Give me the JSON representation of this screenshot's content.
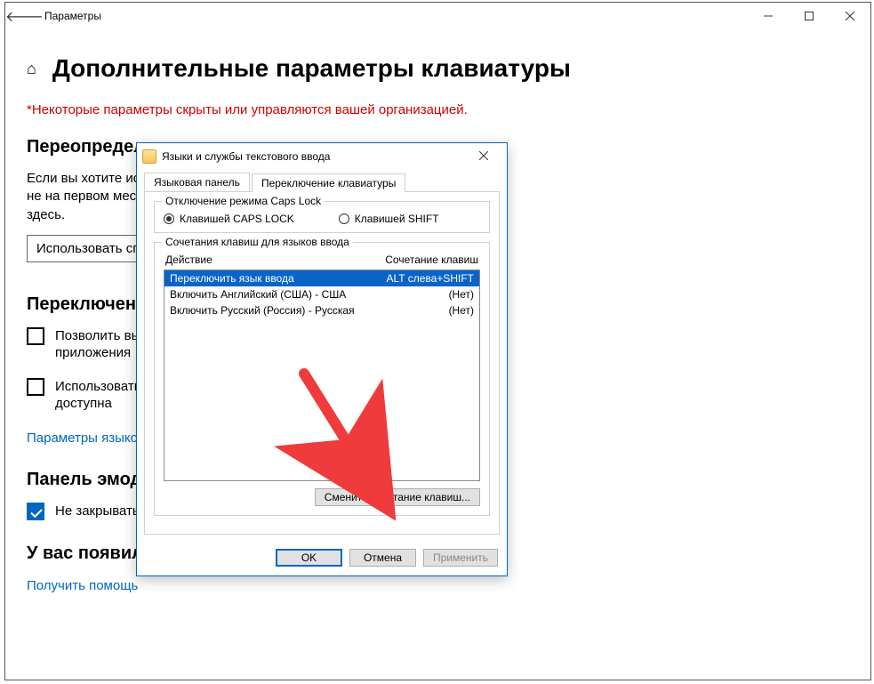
{
  "window": {
    "title": "Параметры"
  },
  "page": {
    "title": "Дополнительные параметры клавиатуры",
    "warning": "*Некоторые параметры скрыты или управляются вашей организацией.",
    "sec_override": "Переопределен",
    "override_para": "Если вы хотите исп.                              не на первом мест.                              здесь.",
    "para_l1": "Если вы хотите исп",
    "para_l2": "не на первом мест",
    "para_l3": "здесь.",
    "dropdown_value": "Использовать сп",
    "sec_switch": "Переключени",
    "chk_allow": "Позволить выб                       приложения",
    "chk_allow_l1": "Позволить выб",
    "chk_allow_l2": "приложения",
    "chk_use_l1": "Использовать",
    "chk_use_l2": "доступна",
    "link_lang": "Параметры языков",
    "sec_emoji": "Панель эмодз",
    "chk_emoji": "Не закрывать панель автоматически после ввода эмодзи",
    "sec_questions": "У вас появились вопросы?",
    "link_help": "Получить помощь"
  },
  "dialog": {
    "title": "Языки и службы текстового ввода",
    "tabs": {
      "lang_panel": "Языковая панель",
      "switch": "Переключение клавиатуры"
    },
    "group_caps": {
      "title": "Отключение режима Caps Lock",
      "opt_caps": "Клавишей CAPS LOCK",
      "opt_shift": "Клавишей SHIFT"
    },
    "group_hotkeys": {
      "title": "Сочетания клавиш для языков ввода",
      "col_action": "Действие",
      "col_short": "Сочетание клавиш",
      "rows": [
        {
          "action": "Переключить язык ввода",
          "shortcut": "ALT слева+SHIFT"
        },
        {
          "action": "Включить Английский (США) - США",
          "shortcut": "(Нет)"
        },
        {
          "action": "Включить Русский (Россия) - Русская",
          "shortcut": "(Нет)"
        }
      ],
      "change_btn": "Сменить сочетание клавиш..."
    },
    "buttons": {
      "ok": "OK",
      "cancel": "Отмена",
      "apply": "Применить"
    }
  }
}
